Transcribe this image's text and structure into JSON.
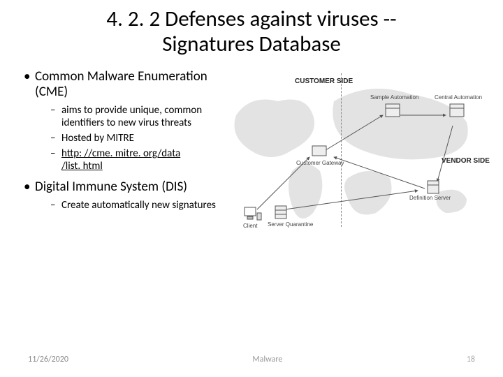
{
  "title_l1": "4. 2. 2  Defenses against viruses --",
  "title_l2": "Signatures Database",
  "bullets": {
    "b1": "Common Malware Enumeration (CME)",
    "b1_sub": {
      "s1": "aims to provide unique, common identifiers to new virus threats",
      "s2": "Hosted by MITRE",
      "s3a": "http: //cme. mitre. org/data",
      "s3b": "/list. html"
    },
    "b2": "Digital Immune System (DIS)",
    "b2_sub": {
      "s1": "Create automatically new signatures"
    }
  },
  "diagram": {
    "customer_side": "CUSTOMER SIDE",
    "vendor_side": "VENDOR SIDE",
    "client": "Client",
    "customer_gateway": "Customer Gateway",
    "server_quarantine": "Server Quarantine",
    "definition_server": "Definition Server",
    "sample_automation": "Sample Automation",
    "central_automation": "Central Automation"
  },
  "footer": {
    "date": "11/26/2020",
    "mid": "Malware",
    "page": "18"
  }
}
